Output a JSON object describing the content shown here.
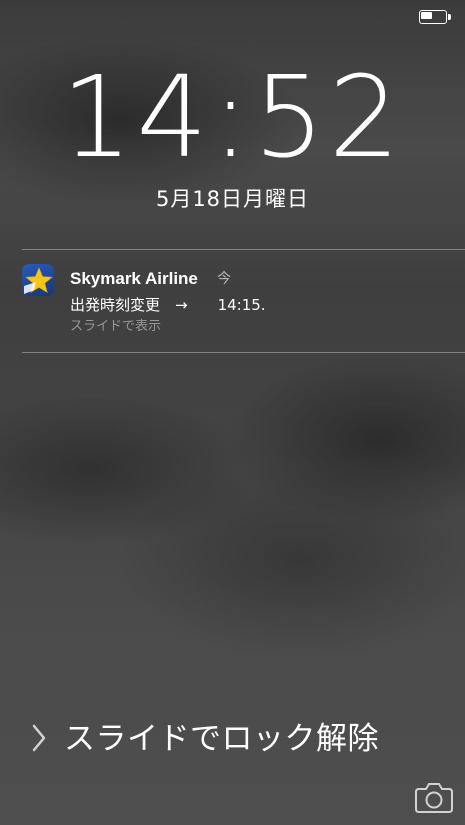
{
  "status_bar": {
    "battery_level": 0.5
  },
  "lock_screen": {
    "time": "14:52",
    "date": "5月18日月曜日"
  },
  "notification": {
    "app_name": "Skymark Airline",
    "time_label": "今",
    "message": "出発時刻変更　→　　14:15.",
    "hint": "スライドで表示",
    "app_icon": "star-logo-icon"
  },
  "unlock": {
    "label": "スライドでロック解除",
    "chevron_icon": "chevron-right-icon"
  },
  "camera": {
    "icon": "camera-icon"
  },
  "colors": {
    "icon_blue": "#2a5bb8",
    "icon_star": "#f5c518"
  }
}
